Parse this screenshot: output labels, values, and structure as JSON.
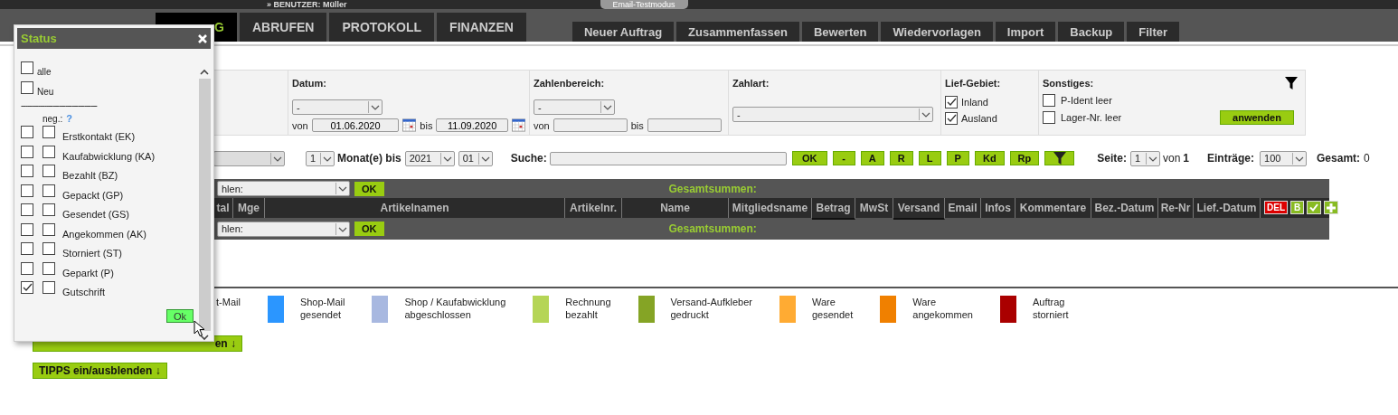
{
  "top_bar": {
    "user_prefix": "»",
    "user_label": "BENUTZER:",
    "user_name": "Müller",
    "badge": "Email-Testmodus"
  },
  "main_tabs": [
    {
      "label": "G",
      "selected": true
    },
    {
      "label": "ABRUFEN",
      "selected": false
    },
    {
      "label": "PROTOKOLL",
      "selected": false
    },
    {
      "label": "FINANZEN",
      "selected": false
    }
  ],
  "sub_tabs": [
    "Neuer Auftrag",
    "Zusammenfassen",
    "Bewerten",
    "Wiedervorlagen",
    "Import",
    "Backup",
    "Filter"
  ],
  "status_popup": {
    "title": "Status",
    "options": [
      {
        "label": "alle",
        "checked": false
      },
      {
        "label": "Neu",
        "checked": false
      }
    ],
    "separator": "------------------------------------",
    "neg_label": "neg.:",
    "help": "?",
    "items": [
      {
        "label": "Erstkontakt (EK)",
        "checked": false,
        "negated": false
      },
      {
        "label": "Kaufabwicklung (KA)",
        "checked": false,
        "negated": false
      },
      {
        "label": "Bezahlt (BZ)",
        "checked": false,
        "negated": false
      },
      {
        "label": "Gepackt (GP)",
        "checked": false,
        "negated": false
      },
      {
        "label": "Gesendet (GS)",
        "checked": false,
        "negated": false
      },
      {
        "label": "Angekommen (AK)",
        "checked": false,
        "negated": false
      },
      {
        "label": "Storniert (ST)",
        "checked": false,
        "negated": false
      },
      {
        "label": "Geparkt (P)",
        "checked": false,
        "negated": false
      },
      {
        "label": "Gutschrift",
        "checked": true,
        "negated": false
      }
    ],
    "ok_button": "Ok"
  },
  "filters": {
    "datum": {
      "label": "Datum:",
      "select": "-",
      "from_label": "von",
      "from": "01.06.2020",
      "to_label": "bis",
      "to": "11.09.2020"
    },
    "zahlenbereich": {
      "label": "Zahlenbereich:",
      "select": "-",
      "from_label": "von",
      "to_label": "bis"
    },
    "zahlart": {
      "label": "Zahlart:",
      "select": "-"
    },
    "lief_gebiet": {
      "label": "Lief-Gebiet:",
      "options": [
        {
          "label": "Inland",
          "checked": true
        },
        {
          "label": "Ausland",
          "checked": true
        }
      ]
    },
    "sonstiges": {
      "label": "Sonstiges:",
      "options": [
        {
          "label": "P-Ident leer",
          "checked": false
        },
        {
          "label": "Lager-Nr. leer",
          "checked": false
        }
      ],
      "apply_button": "anwenden"
    }
  },
  "toolbar": {
    "months": "1",
    "months_label": "Monat(e) bis",
    "year": "2021",
    "month": "01",
    "search_label": "Suche:",
    "buttons": [
      "OK",
      "-",
      "A",
      "R",
      "L",
      "P",
      "Kd",
      "Rp"
    ],
    "page_label": "Seite:",
    "page": "1",
    "of_label": "von",
    "pages": "1",
    "entries_label": "Einträge:",
    "entries": "100",
    "total_label": "Gesamt:",
    "total": "0"
  },
  "table": {
    "action_select": "hlen:",
    "ok_button": "OK",
    "totals_label": "Gesamtsummen:",
    "columns": [
      {
        "label": "tal",
        "underlined": false
      },
      {
        "label": "Mge",
        "underlined": false
      },
      {
        "label": "Artikelnamen",
        "underlined": false
      },
      {
        "label": "Artikelnr.",
        "underlined": false
      },
      {
        "label": "Name",
        "underlined": false
      },
      {
        "label": "Mitgliedsname",
        "underlined": false
      },
      {
        "label": "Betrag",
        "underlined": true
      },
      {
        "label": "MwSt",
        "underlined": false
      },
      {
        "label": "Versand",
        "underlined": true
      },
      {
        "label": "Email",
        "underlined": false
      },
      {
        "label": "Infos",
        "underlined": false
      },
      {
        "label": "Kommentare",
        "underlined": false
      },
      {
        "label": "Bez.-Datum",
        "underlined": false
      },
      {
        "label": "Re-Nr",
        "underlined": false
      },
      {
        "label": "Lief.-Datum",
        "underlined": false
      }
    ],
    "del_button": "DEL",
    "b_button": "B",
    "bottom_action_select": "hlen:",
    "bottom_ok_button": "OK",
    "bottom_totals_label": "Gesamtsummen:"
  },
  "legend": [
    {
      "lines": [
        "t-Mail"
      ]
    },
    {
      "color": "#2b96ff",
      "lines": [
        "Shop-Mail",
        "gesendet"
      ]
    },
    {
      "color": "#a8b8e0",
      "lines": [
        "Shop / Kaufabwicklung",
        "abgeschlossen"
      ]
    },
    {
      "color": "#b5d556",
      "lines": [
        "Rechnung",
        "bezahlt"
      ]
    },
    {
      "color": "#85a425",
      "lines": [
        "Versand-Aufkleber",
        "gedruckt"
      ]
    },
    {
      "color": "#ffab33",
      "lines": [
        "Ware",
        "gesendet"
      ]
    },
    {
      "color": "#f08000",
      "lines": [
        "Ware",
        "angekommen"
      ]
    },
    {
      "color": "#aa0000",
      "lines": [
        "Auftrag",
        "storniert"
      ]
    }
  ],
  "buttons": [
    {
      "label": "en ↓"
    },
    {
      "label": "TIPPS ein/ausblenden ↓"
    }
  ]
}
